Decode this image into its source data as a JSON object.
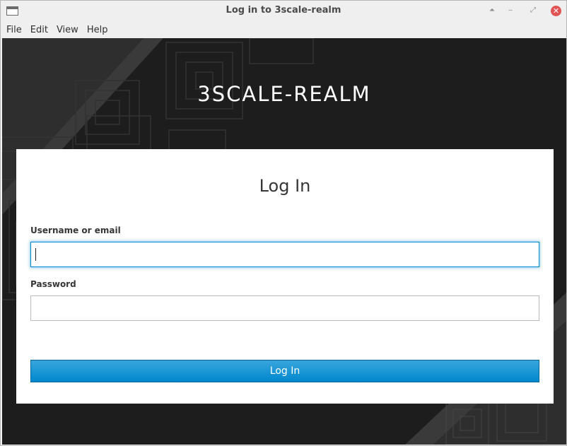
{
  "window": {
    "title": "Log in to 3scale-realm",
    "icons": [
      "app-window-icon",
      "shade-icon",
      "minimize-icon",
      "maximize-icon",
      "close-icon"
    ],
    "controls": {
      "shade": "⏶",
      "minimize": "‒",
      "maximize": "⤢",
      "close": "✕"
    }
  },
  "menubar": {
    "items": [
      {
        "label": "File"
      },
      {
        "label": "Edit"
      },
      {
        "label": "View"
      },
      {
        "label": "Help"
      }
    ]
  },
  "page": {
    "realm_title": "3SCALE-REALM",
    "form": {
      "heading": "Log In",
      "username_label": "Username or email",
      "username_value": "",
      "password_label": "Password",
      "password_value": "",
      "submit_label": "Log In"
    }
  },
  "colors": {
    "background": "#1d1d1d",
    "accent": "#0088ce",
    "button_top": "#39a5dc",
    "close_button": "#e05454"
  }
}
